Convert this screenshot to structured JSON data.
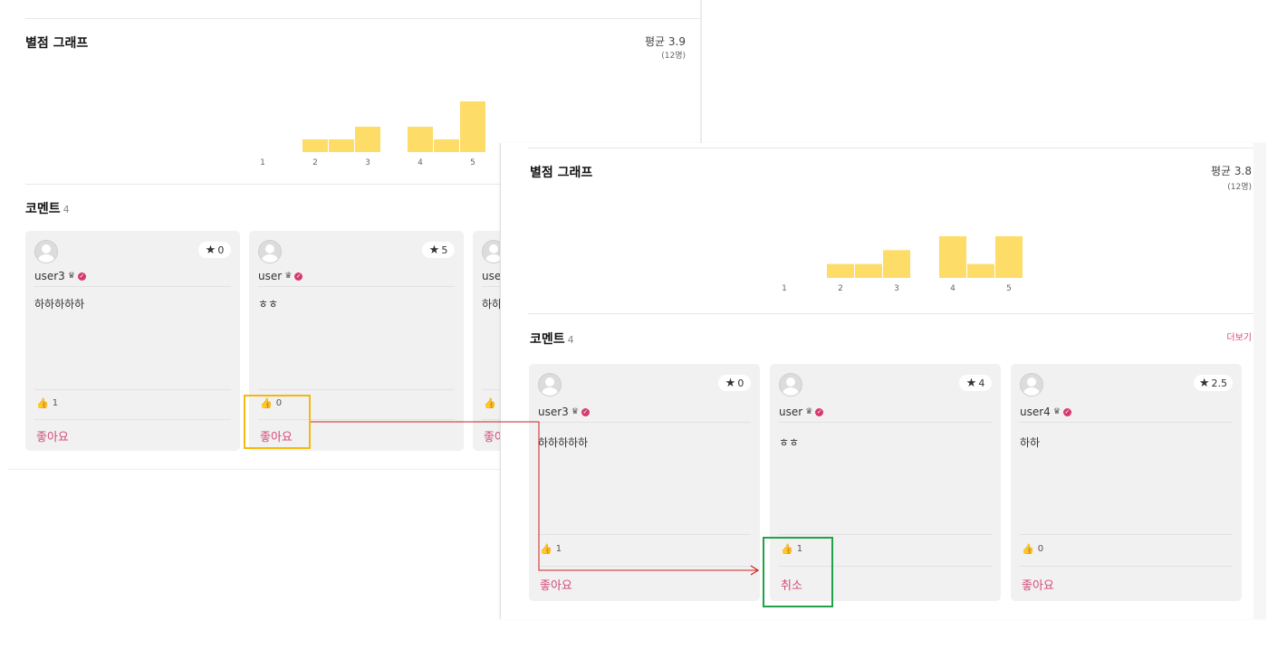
{
  "colors": {
    "bar": "#fddc68",
    "accent": "#d44a7a",
    "arrow": "#cc2222",
    "highlight_before": "#f5b80d",
    "highlight_after": "#1fa347"
  },
  "before": {
    "rating_section": {
      "title": "별점 그래프",
      "average": "평균 3.9",
      "respondents": "(12명)"
    },
    "comments_section": {
      "title": "코멘트",
      "count": "4"
    },
    "comments": [
      {
        "username": "user3",
        "rating": "0",
        "text": "하하하하하",
        "likes": "1",
        "like_label": "좋아요"
      },
      {
        "username": "user",
        "rating": "5",
        "text": "ㅎㅎ",
        "likes": "0",
        "like_label": "좋아요"
      },
      {
        "username": "use",
        "rating": "",
        "text": "하하",
        "likes": "",
        "like_label": "좋아요"
      }
    ]
  },
  "after": {
    "rating_section": {
      "title": "별점 그래프",
      "average": "평균 3.8",
      "respondents": "(12명)"
    },
    "comments_section": {
      "title": "코멘트",
      "count": "4",
      "more_label": "더보기"
    },
    "comments": [
      {
        "username": "user3",
        "rating": "0",
        "text": "하하하하하",
        "likes": "1",
        "like_label": "좋아요"
      },
      {
        "username": "user",
        "rating": "4",
        "text": "ㅎㅎ",
        "likes": "1",
        "like_label": "취소"
      },
      {
        "username": "user4",
        "rating": "2.5",
        "text": "하하",
        "likes": "0",
        "like_label": "좋아요"
      }
    ]
  },
  "chart_data": [
    {
      "type": "bar",
      "categories": [
        "1",
        "1.5",
        "2",
        "2.5",
        "3",
        "3.5",
        "4",
        "4.5",
        "5"
      ],
      "values": [
        0,
        0,
        1,
        1,
        2,
        0,
        2,
        1,
        4
      ],
      "tick_labels": [
        "1",
        "2",
        "3",
        "4",
        "5"
      ],
      "ylim": [
        0,
        4
      ],
      "grid": false
    },
    {
      "type": "bar",
      "categories": [
        "1",
        "1.5",
        "2",
        "2.5",
        "3",
        "3.5",
        "4",
        "4.5",
        "5"
      ],
      "values": [
        0,
        0,
        1,
        1,
        2,
        0,
        3,
        1,
        3
      ],
      "tick_labels": [
        "1",
        "2",
        "3",
        "4",
        "5"
      ],
      "ylim": [
        0,
        3
      ],
      "grid": false
    }
  ]
}
